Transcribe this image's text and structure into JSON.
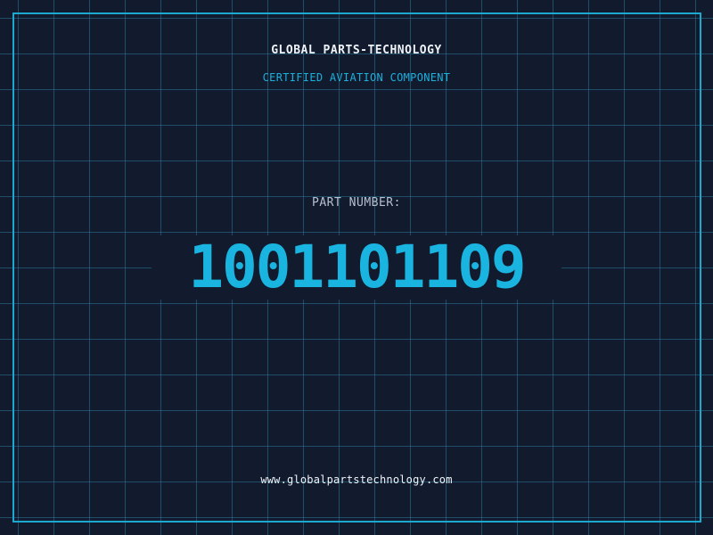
{
  "header": {
    "company": "GLOBAL PARTS-TECHNOLOGY",
    "tagline": "CERTIFIED AVIATION COMPONENT"
  },
  "part": {
    "label": "PART NUMBER:",
    "number": "1001101109"
  },
  "footer": {
    "website": "www.globalpartstechnology.com"
  },
  "colors": {
    "background": "#121a2e",
    "grid": "#28789a",
    "accent": "#19b4df",
    "frame": "#1da8cf",
    "text": "#eef3f8",
    "label": "#b7c1cf"
  }
}
